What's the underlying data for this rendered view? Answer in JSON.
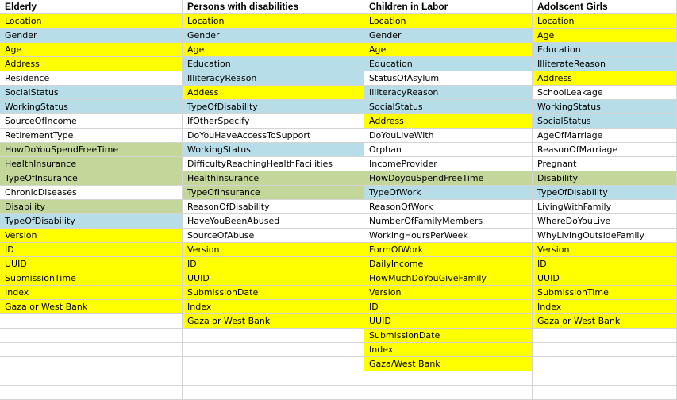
{
  "colors": {
    "yellow": "#ffff00",
    "blue": "#b7dde8",
    "green": "#c4d79b",
    "white": "#ffffff"
  },
  "rows": [
    [
      {
        "text": "Elderly",
        "color": "white",
        "header": true
      },
      {
        "text": "Persons with disabilities",
        "color": "white",
        "header": true
      },
      {
        "text": "Children in Labor",
        "color": "white",
        "header": true
      },
      {
        "text": "Adolscent Girls",
        "color": "white",
        "header": true
      }
    ],
    [
      {
        "text": "Location",
        "color": "yellow"
      },
      {
        "text": "Location",
        "color": "yellow"
      },
      {
        "text": "Location",
        "color": "yellow"
      },
      {
        "text": "Location",
        "color": "yellow"
      }
    ],
    [
      {
        "text": "Gender",
        "color": "blue"
      },
      {
        "text": "Gender",
        "color": "blue"
      },
      {
        "text": "Gender",
        "color": "blue"
      },
      {
        "text": "Age",
        "color": "yellow"
      }
    ],
    [
      {
        "text": "Age",
        "color": "yellow"
      },
      {
        "text": "Age",
        "color": "yellow"
      },
      {
        "text": "Age",
        "color": "yellow"
      },
      {
        "text": "Education",
        "color": "blue"
      }
    ],
    [
      {
        "text": "Address",
        "color": "yellow"
      },
      {
        "text": "Education",
        "color": "blue"
      },
      {
        "text": "Education",
        "color": "blue"
      },
      {
        "text": "IlliterateReason",
        "color": "blue"
      }
    ],
    [
      {
        "text": "Residence",
        "color": "white"
      },
      {
        "text": "IlliteracyReason",
        "color": "blue"
      },
      {
        "text": "StatusOfAsylum",
        "color": "white"
      },
      {
        "text": "Address",
        "color": "yellow"
      }
    ],
    [
      {
        "text": "SocialStatus",
        "color": "blue"
      },
      {
        "text": "Addess",
        "color": "yellow"
      },
      {
        "text": "IlliteracyReason",
        "color": "blue"
      },
      {
        "text": "SchoolLeakage",
        "color": "white"
      }
    ],
    [
      {
        "text": "WorkingStatus",
        "color": "blue"
      },
      {
        "text": "TypeOfDisability",
        "color": "blue"
      },
      {
        "text": "SocialStatus",
        "color": "blue"
      },
      {
        "text": "WorkingStatus",
        "color": "blue"
      }
    ],
    [
      {
        "text": "SourceOfIncome",
        "color": "white"
      },
      {
        "text": "IfOtherSpecify",
        "color": "white"
      },
      {
        "text": "Address",
        "color": "yellow"
      },
      {
        "text": "SocialStatus",
        "color": "blue"
      }
    ],
    [
      {
        "text": "RetirementType",
        "color": "white"
      },
      {
        "text": "DoYouHaveAccessToSupport",
        "color": "white"
      },
      {
        "text": "DoYouLiveWith",
        "color": "white"
      },
      {
        "text": "AgeOfMarriage",
        "color": "white"
      }
    ],
    [
      {
        "text": "HowDoYouSpendFreeTime",
        "color": "green"
      },
      {
        "text": "WorkingStatus",
        "color": "blue"
      },
      {
        "text": "Orphan",
        "color": "white"
      },
      {
        "text": "ReasonOfMarriage",
        "color": "white"
      }
    ],
    [
      {
        "text": "HealthInsurance",
        "color": "green"
      },
      {
        "text": "DifficultyReachingHealthFacilities",
        "color": "white"
      },
      {
        "text": "IncomeProvider",
        "color": "white"
      },
      {
        "text": "Pregnant",
        "color": "white"
      }
    ],
    [
      {
        "text": "TypeOfInsurance",
        "color": "green"
      },
      {
        "text": "HealthInsurance",
        "color": "green"
      },
      {
        "text": "HowDoyouSpendFreeTime",
        "color": "green"
      },
      {
        "text": "Disability",
        "color": "green"
      }
    ],
    [
      {
        "text": "ChronicDiseases",
        "color": "white"
      },
      {
        "text": "TypeOfInsurance",
        "color": "green"
      },
      {
        "text": "TypeOfWork",
        "color": "blue"
      },
      {
        "text": "TypeOfDisability",
        "color": "blue"
      }
    ],
    [
      {
        "text": "Disability",
        "color": "green"
      },
      {
        "text": "ReasonOfDisability",
        "color": "white"
      },
      {
        "text": "ReasonOfWork",
        "color": "white"
      },
      {
        "text": "LivingWithFamily",
        "color": "white"
      }
    ],
    [
      {
        "text": "TypeOfDisability",
        "color": "blue"
      },
      {
        "text": "HaveYouBeenAbused",
        "color": "white"
      },
      {
        "text": "NumberOfFamilyMembers",
        "color": "white"
      },
      {
        "text": "WhereDoYouLive",
        "color": "white"
      }
    ],
    [
      {
        "text": "Version",
        "color": "yellow"
      },
      {
        "text": "SourceOfAbuse",
        "color": "white"
      },
      {
        "text": "WorkingHoursPerWeek",
        "color": "white"
      },
      {
        "text": "WhyLivingOutsideFamily",
        "color": "white"
      }
    ],
    [
      {
        "text": "ID",
        "color": "yellow"
      },
      {
        "text": "Version",
        "color": "yellow"
      },
      {
        "text": "FormOfWork",
        "color": "yellow"
      },
      {
        "text": "Version",
        "color": "yellow"
      }
    ],
    [
      {
        "text": "UUID",
        "color": "yellow"
      },
      {
        "text": "ID",
        "color": "yellow"
      },
      {
        "text": "DailyIncome",
        "color": "yellow"
      },
      {
        "text": "ID",
        "color": "yellow"
      }
    ],
    [
      {
        "text": "SubmissionTime",
        "color": "yellow"
      },
      {
        "text": "UUID",
        "color": "yellow"
      },
      {
        "text": "HowMuchDoYouGiveFamily",
        "color": "yellow"
      },
      {
        "text": "UUID",
        "color": "yellow"
      }
    ],
    [
      {
        "text": "Index",
        "color": "yellow"
      },
      {
        "text": "SubmissionDate",
        "color": "yellow"
      },
      {
        "text": "Version",
        "color": "yellow"
      },
      {
        "text": "SubmissionTime",
        "color": "yellow"
      }
    ],
    [
      {
        "text": "Gaza or West Bank",
        "color": "yellow"
      },
      {
        "text": "Index",
        "color": "yellow"
      },
      {
        "text": "ID",
        "color": "yellow"
      },
      {
        "text": "Index",
        "color": "yellow"
      }
    ],
    [
      {
        "text": "",
        "color": "white"
      },
      {
        "text": "Gaza or West Bank",
        "color": "yellow"
      },
      {
        "text": "UUID",
        "color": "yellow"
      },
      {
        "text": "Gaza or West Bank",
        "color": "yellow"
      }
    ],
    [
      {
        "text": "",
        "color": "white"
      },
      {
        "text": "",
        "color": "white"
      },
      {
        "text": "SubmissionDate",
        "color": "yellow"
      },
      {
        "text": "",
        "color": "white"
      }
    ],
    [
      {
        "text": "",
        "color": "white"
      },
      {
        "text": "",
        "color": "white"
      },
      {
        "text": "Index",
        "color": "yellow"
      },
      {
        "text": "",
        "color": "white"
      }
    ],
    [
      {
        "text": "",
        "color": "white"
      },
      {
        "text": "",
        "color": "white"
      },
      {
        "text": "Gaza/West Bank",
        "color": "yellow"
      },
      {
        "text": "",
        "color": "white"
      }
    ],
    [
      {
        "text": "",
        "color": "white"
      },
      {
        "text": "",
        "color": "white"
      },
      {
        "text": "",
        "color": "white"
      },
      {
        "text": "",
        "color": "white"
      }
    ],
    [
      {
        "text": "",
        "color": "white"
      },
      {
        "text": "",
        "color": "white"
      },
      {
        "text": "",
        "color": "white"
      },
      {
        "text": "",
        "color": "white"
      }
    ]
  ]
}
